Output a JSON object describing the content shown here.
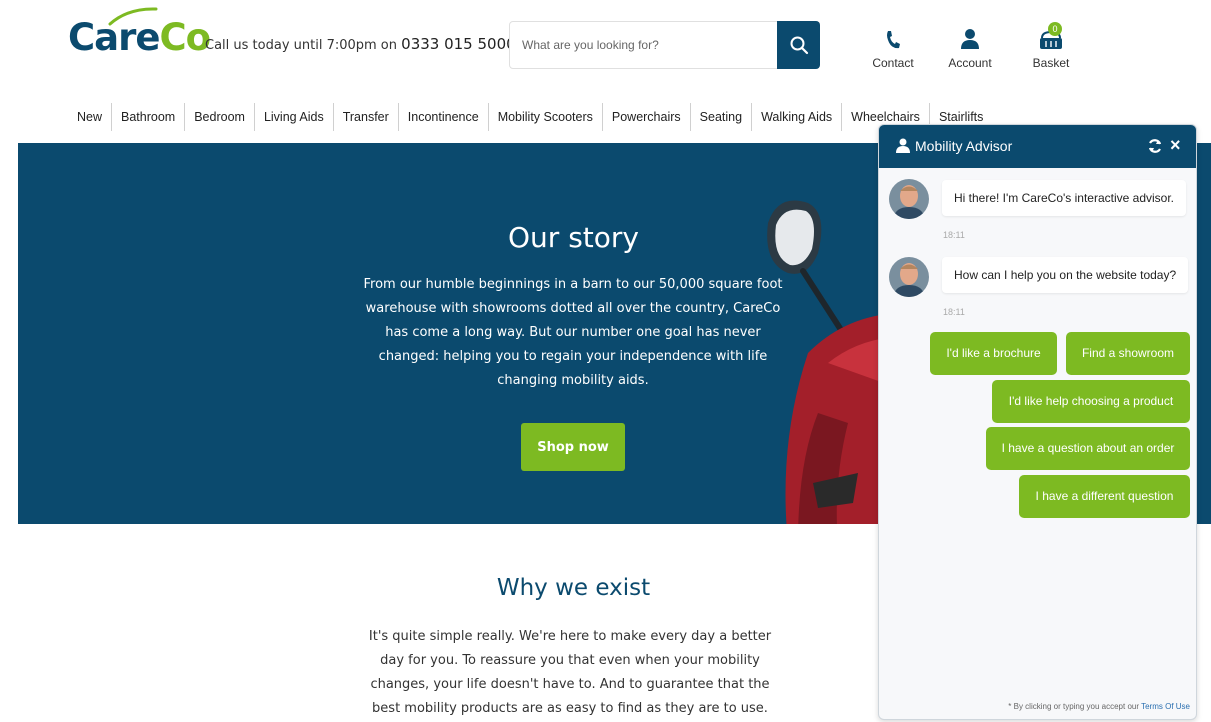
{
  "brand": {
    "name_part1": "Care",
    "name_part2": "Co",
    "color_primary": "#0b4a6e",
    "color_accent": "#7dba22"
  },
  "header": {
    "phone_prefix": "Call us today until 7:00pm on",
    "phone_number": "0333 015 5000",
    "search_placeholder": "What are you looking for?",
    "search_icon": "search-icon",
    "links": {
      "contact": "Contact",
      "account": "Account",
      "basket": "Basket"
    },
    "basket_count": "0"
  },
  "nav": {
    "items": [
      "New",
      "Bathroom",
      "Bedroom",
      "Living Aids",
      "Transfer",
      "Incontinence",
      "Mobility Scooters",
      "Powerchairs",
      "Seating",
      "Walking Aids",
      "Wheelchairs",
      "Stairlifts"
    ]
  },
  "hero": {
    "title": "Our story",
    "text": "From our humble beginnings in a barn to our 50,000 square foot warehouse with showrooms dotted all over the country, CareCo has come a long way. But our number one goal has never changed: helping you to regain your independence with life changing mobility aids.",
    "button": "Shop now"
  },
  "why": {
    "title": "Why we exist",
    "text": "It's quite simple really. We're here to make every day a better day for you. To reassure you that even when your mobility changes, your life doesn't have to. And to guarantee that the best mobility products are as easy to find as they are to use."
  },
  "chat": {
    "title": "Mobility Advisor",
    "messages": [
      {
        "text": "Hi there! I'm CareCo's interactive advisor.",
        "time": "18:11"
      },
      {
        "text": "How can I help you on the website today?",
        "time": "18:11"
      }
    ],
    "quick_replies": [
      "I'd like a brochure",
      "Find a showroom",
      "I'd like help choosing a product",
      "I have a question about an order",
      "I have a different question"
    ],
    "terms_prefix": "* By clicking or typing you accept our",
    "terms_link": "Terms Of Use"
  }
}
